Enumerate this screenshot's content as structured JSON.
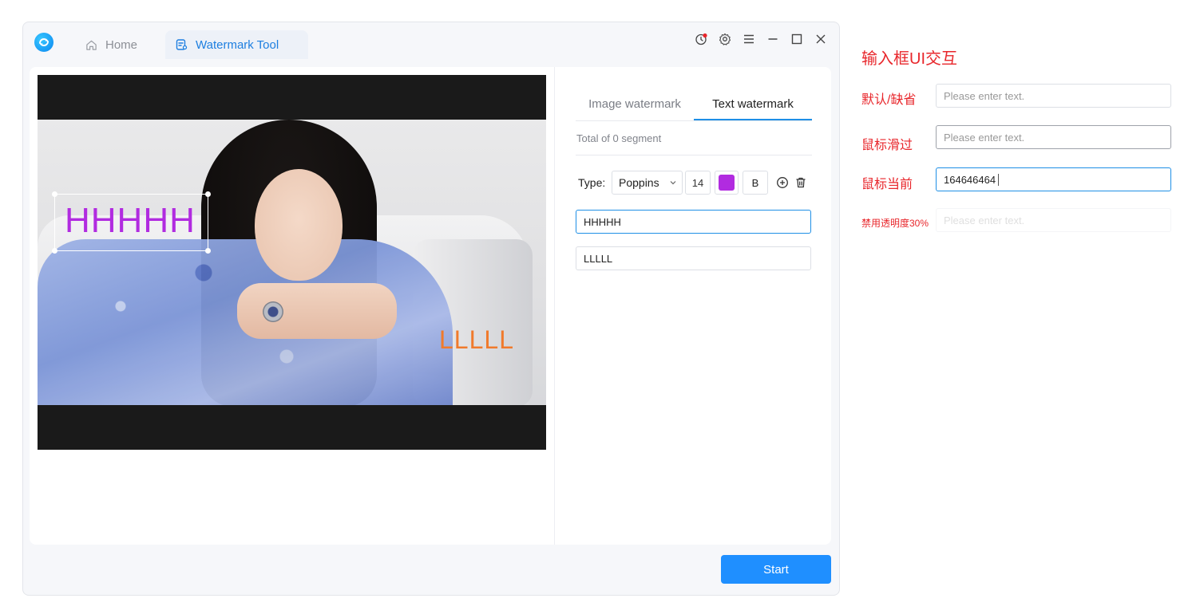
{
  "window": {
    "tabs": [
      {
        "label": "Home"
      },
      {
        "label": "Watermark Tool"
      }
    ]
  },
  "preview": {
    "watermark_texts": [
      {
        "text": "HHHHH",
        "color": "#b12be0"
      },
      {
        "text": "LLLLL",
        "color": "#f07a2c"
      }
    ]
  },
  "side": {
    "tabs": [
      "Image watermark",
      "Text watermark"
    ],
    "active_tab": "Text watermark",
    "segment_count": "Total of 0 segment",
    "type_label": "Type:",
    "font": "Poppins",
    "size": "14",
    "color": "#b12be0",
    "bold_label": "B",
    "entries": [
      "HHHHH",
      "LLLLL"
    ]
  },
  "start_label": "Start",
  "spec": {
    "title": "输入框UI交互",
    "rows": [
      {
        "label": "默认/缺省",
        "placeholder": "Please enter text.",
        "value": ""
      },
      {
        "label": "鼠标滑过",
        "placeholder": "Please enter text.",
        "value": ""
      },
      {
        "label": "鼠标当前",
        "placeholder": "",
        "value": "164646464"
      },
      {
        "label": "禁用透明度30%",
        "placeholder": "Please enter text.",
        "value": ""
      }
    ]
  },
  "colors": {
    "accent": "#1f8fff",
    "spec_red": "#e8262b"
  }
}
